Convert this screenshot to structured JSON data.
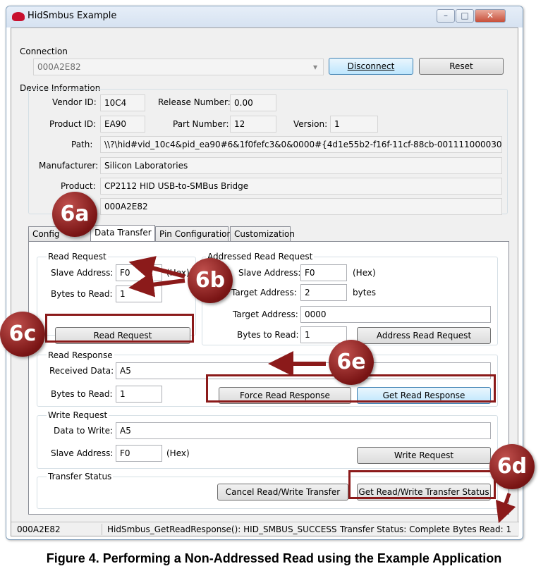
{
  "window": {
    "title": "HidSmbus Example",
    "minimize": "–",
    "maximize": "□",
    "close": "✕"
  },
  "connection": {
    "group_label": "Connection",
    "device_value": "000A2E82",
    "disconnect_label": "Disconnect",
    "reset_label": "Reset"
  },
  "device_info": {
    "group_label": "Device Information",
    "vendor_id_label": "Vendor ID:",
    "vendor_id": "10C4",
    "release_label": "Release Number:",
    "release": "0.00",
    "product_id_label": "Product ID:",
    "product_id": "EA90",
    "part_label": "Part Number:",
    "part": "12",
    "version_label": "Version:",
    "version": "1",
    "path_label": "Path:",
    "path": "\\\\?\\hid#vid_10c4&pid_ea90#6&1f0fefc3&0&0000#{4d1e55b2-f16f-11cf-88cb-001111000030}",
    "manufacturer_label": "Manufacturer:",
    "manufacturer": "Silicon Laboratories",
    "product_label": "Product:",
    "product": "CP2112 HID USB-to-SMBus Bridge",
    "serial": "000A2E82"
  },
  "tabs": [
    "Configuration",
    "Data Transfer",
    "Pin Configuration",
    "Customization"
  ],
  "tab_visible": {
    "config": "Config",
    "data": "Data Transfer"
  },
  "read_request": {
    "group_label": "Read Request",
    "slave_label": "Slave Address:",
    "slave": "F0",
    "hex": "(Hex)",
    "bytes_label": "Bytes to Read:",
    "bytes": "1",
    "button": "Read Request"
  },
  "addressed_read": {
    "group_label": "Addressed Read Request",
    "slave_label": "Slave Address:",
    "slave": "F0",
    "hex": "(Hex)",
    "target_label": "Target Address:",
    "target": "2",
    "bytes_unit": "bytes",
    "target2_label": "Target Address:",
    "target2": "0000",
    "bytes_label": "Bytes to Read:",
    "bytes": "1",
    "button": "Address Read Request"
  },
  "read_response": {
    "group_label": "Read Response",
    "received_label": "Received Data:",
    "received": "A5",
    "bytes_label": "Bytes to Read:",
    "bytes": "1",
    "force_button": "Force Read Response",
    "get_button": "Get Read Response"
  },
  "write_request": {
    "group_label": "Write Request",
    "data_label": "Data to Write:",
    "data": "A5",
    "slave_label": "Slave Address:",
    "slave": "F0",
    "hex": "(Hex)",
    "button": "Write Request"
  },
  "transfer_status": {
    "group_label": "Transfer Status",
    "cancel_button": "Cancel Read/Write Transfer",
    "get_button": "Get Read/Write Transfer Status"
  },
  "statusbar": {
    "device": "000A2E82",
    "message": "HidSmbus_GetReadResponse(): HID_SMBUS_SUCCESS",
    "transfer": "Transfer Status: Complete",
    "bytes": "Bytes Read: 1"
  },
  "callouts": {
    "a": "6a",
    "b": "6b",
    "c": "6c",
    "d": "6d",
    "e": "6e"
  },
  "caption": "Figure 4. Performing a Non-Addressed Read using the Example Application",
  "colors": {
    "callout": "#8b1a1a",
    "button_focus": "#bee6fd"
  }
}
